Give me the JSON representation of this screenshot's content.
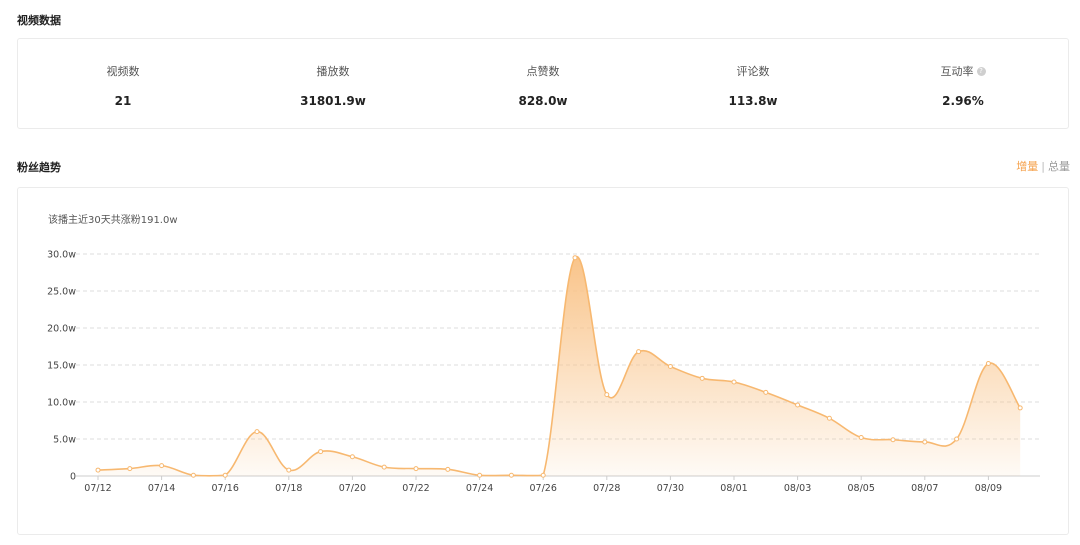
{
  "video_section": {
    "title": "视频数据",
    "stats": [
      {
        "label": "视频数",
        "value": "21"
      },
      {
        "label": "播放数",
        "value": "31801.9w"
      },
      {
        "label": "点赞数",
        "value": "828.0w"
      },
      {
        "label": "评论数",
        "value": "113.8w"
      },
      {
        "label": "互动率",
        "value": "2.96%"
      }
    ]
  },
  "fans_section": {
    "title": "粉丝趋势",
    "toggle": {
      "active": "增量",
      "separator": "|",
      "inactive": "总量"
    },
    "summary": "该播主近30天共涨粉191.0w"
  },
  "colors": {
    "accent": "#f5a04a",
    "line": "#f7b870",
    "fill_top": "#f9c48a"
  },
  "chart_data": {
    "type": "area",
    "x": [
      "07/12",
      "07/13",
      "07/14",
      "07/15",
      "07/16",
      "07/17",
      "07/18",
      "07/19",
      "07/20",
      "07/21",
      "07/22",
      "07/23",
      "07/24",
      "07/25",
      "07/26",
      "07/27",
      "07/28",
      "07/29",
      "07/30",
      "07/31",
      "08/01",
      "08/02",
      "08/03",
      "08/04",
      "08/05",
      "08/06",
      "08/07",
      "08/08",
      "08/09",
      "08/10"
    ],
    "x_tick_labels": [
      "07/12",
      "07/14",
      "07/16",
      "07/18",
      "07/20",
      "07/22",
      "07/24",
      "07/26",
      "07/28",
      "07/30",
      "08/01",
      "08/03",
      "08/05",
      "08/07",
      "08/09"
    ],
    "values": [
      0.8,
      1.0,
      1.4,
      0.1,
      0.1,
      6.0,
      0.8,
      3.3,
      2.6,
      1.2,
      1.0,
      0.9,
      0.1,
      0.1,
      0.1,
      29.5,
      11.0,
      16.8,
      14.8,
      13.2,
      12.7,
      11.3,
      9.6,
      7.8,
      5.2,
      4.9,
      4.6,
      5.0,
      15.2,
      9.2
    ],
    "y_ticks": [
      0,
      5.0,
      10.0,
      15.0,
      20.0,
      25.0,
      30.0
    ],
    "y_tick_labels": [
      "0",
      "5.0w",
      "10.0w",
      "15.0w",
      "20.0w",
      "25.0w",
      "30.0w"
    ],
    "ylim": [
      0,
      30
    ],
    "grid": true,
    "legend": "none"
  }
}
